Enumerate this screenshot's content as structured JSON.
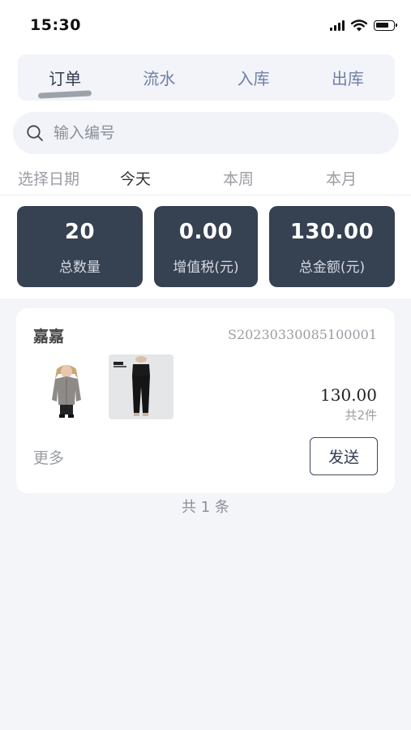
{
  "status_bar": {
    "time": "15:30"
  },
  "tabs": [
    {
      "label": "订单",
      "active": true
    },
    {
      "label": "流水",
      "active": false
    },
    {
      "label": "入库",
      "active": false
    },
    {
      "label": "出库",
      "active": false
    }
  ],
  "search": {
    "placeholder": "输入编号",
    "value": ""
  },
  "date_filter": {
    "label": "选择日期",
    "options": [
      {
        "label": "今天",
        "active": true
      },
      {
        "label": "本周",
        "active": false
      },
      {
        "label": "本月",
        "active": false
      }
    ]
  },
  "stats": [
    {
      "value": "20",
      "label": "总数量"
    },
    {
      "value": "0.00",
      "label": "增值税(元)"
    },
    {
      "value": "130.00",
      "label": "总金额(元)"
    }
  ],
  "orders": [
    {
      "customer": "嘉嘉",
      "order_no": "S20230330085100001",
      "products": [
        "gray-hoodie-photo",
        "black-trousers-photo"
      ],
      "amount": "130.00",
      "quantity": "共2件",
      "more_label": "更多",
      "send_label": "发送"
    }
  ],
  "footer": {
    "total": "共 1 条"
  },
  "colors": {
    "accent_dark": "#364152",
    "tab_inactive": "#6f7fa6",
    "page_bg": "#f3f5f9"
  }
}
